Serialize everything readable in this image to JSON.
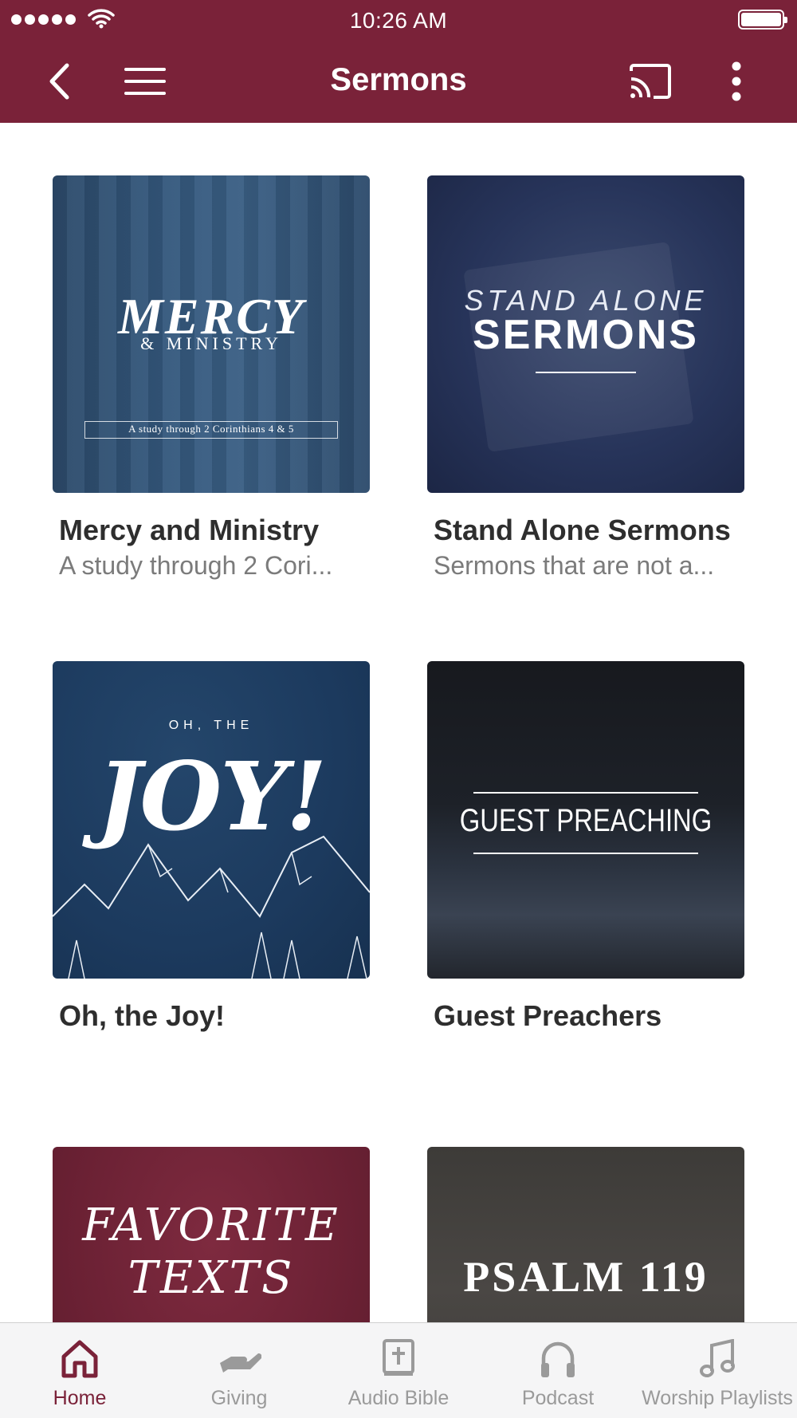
{
  "status_bar": {
    "time": "10:26 AM"
  },
  "header": {
    "title": "Sermons"
  },
  "icons": {
    "back": "chevron-left-icon",
    "menu": "hamburger-menu-icon",
    "cast": "cast-icon",
    "more": "more-vertical-icon"
  },
  "colors": {
    "brand": "#7a2239",
    "tab_inactive": "#9a9a9a"
  },
  "series": [
    {
      "title": "Mercy and Ministry",
      "subtitle": "A study through 2 Cori...",
      "art": {
        "headline": "MERCY",
        "subline": "& MINISTRY",
        "caption": "A study through 2 Corinthians 4 & 5"
      }
    },
    {
      "title": "Stand Alone Sermons",
      "subtitle": "Sermons that are not a...",
      "art": {
        "top": "STAND ALONE",
        "headline": "SERMONS"
      }
    },
    {
      "title": "Oh, the Joy!",
      "subtitle": "",
      "art": {
        "top": "OH, THE",
        "headline": "JOY!"
      }
    },
    {
      "title": "Guest Preachers",
      "subtitle": "",
      "art": {
        "headline": "GUEST PREACHING"
      }
    },
    {
      "title": "",
      "subtitle": "",
      "art": {
        "line1": "FAVORITE",
        "line2": "TEXTS"
      }
    },
    {
      "title": "",
      "subtitle": "",
      "art": {
        "headline": "PSALM 119"
      }
    }
  ],
  "tabs": [
    {
      "label": "Home",
      "icon": "home-icon",
      "active": true
    },
    {
      "label": "Giving",
      "icon": "giving-hand-icon",
      "active": false
    },
    {
      "label": "Audio Bible",
      "icon": "bible-icon",
      "active": false
    },
    {
      "label": "Podcast",
      "icon": "headphones-icon",
      "active": false
    },
    {
      "label": "Worship Playlists",
      "icon": "music-note-icon",
      "active": false
    }
  ]
}
